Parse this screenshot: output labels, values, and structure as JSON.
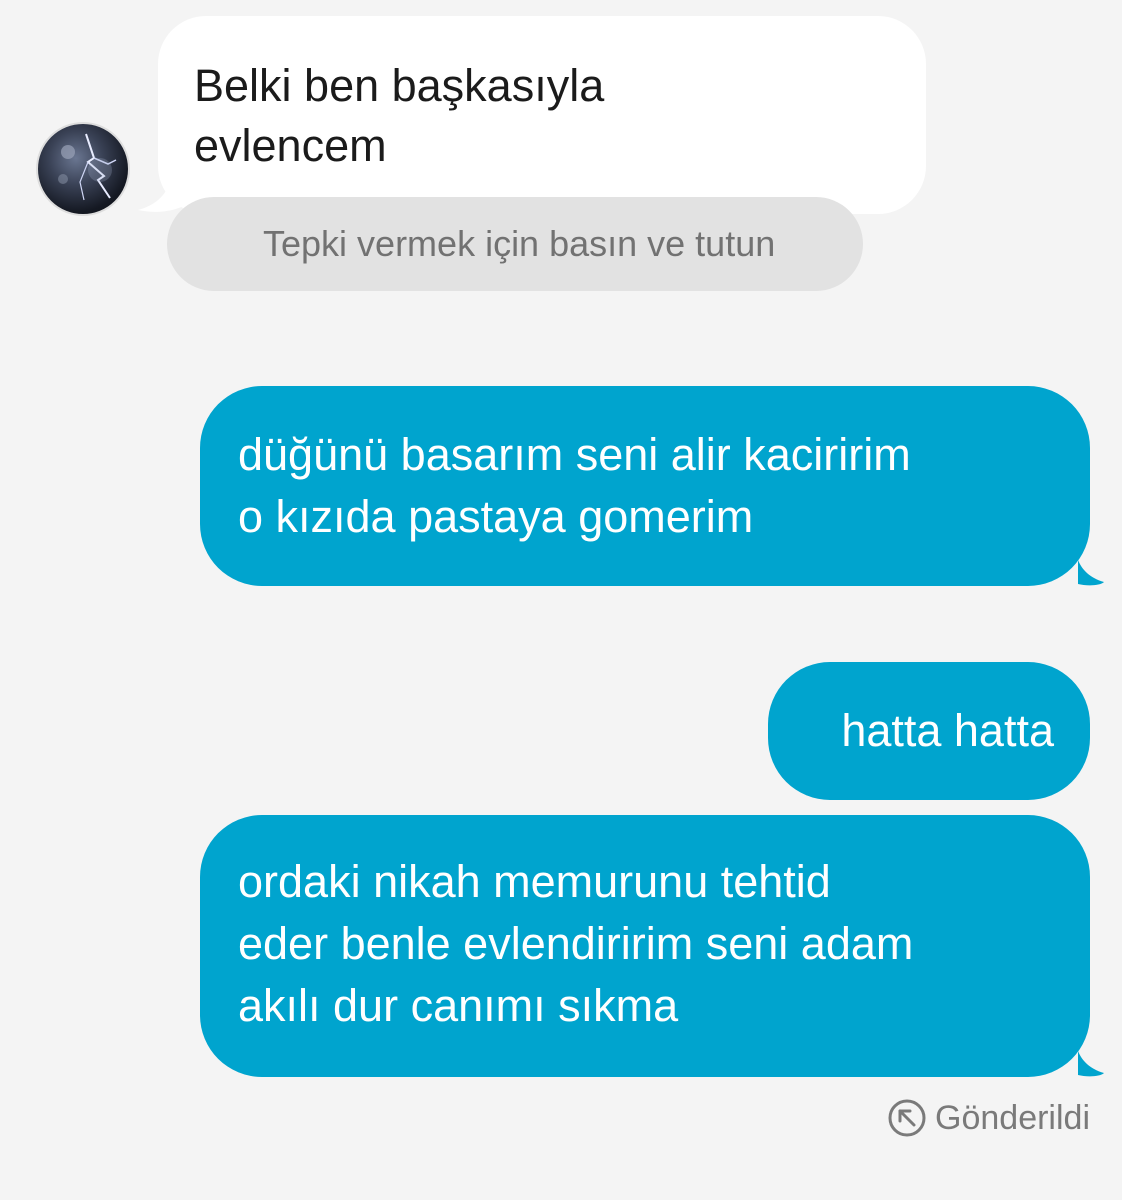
{
  "incoming": {
    "avatar_icon": "lightning-storm-avatar",
    "lines": [
      "Belki ben başkasıyla",
      "evlencem"
    ],
    "reaction_hint": "Tepki vermek için basın ve tutun"
  },
  "outgoing": [
    {
      "lines": [
        "düğünü basarım seni alir kaciririm",
        "o kızıda pastaya gomerim"
      ]
    },
    {
      "lines": [
        "hatta hatta"
      ]
    },
    {
      "lines": [
        "ordaki nikah memurunu tehtid",
        "eder benle evlendiririm seni adam",
        "akılı dur canımı sıkma"
      ]
    }
  ],
  "status": {
    "icon": "sent-arrow-icon",
    "label": "Gönderildi"
  },
  "colors": {
    "background": "#f4f4f4",
    "incoming_bubble": "#ffffff",
    "outgoing_bubble": "#00a4ce",
    "reaction_hint_bg": "#e2e2e2",
    "muted_text": "#7a7a7a"
  }
}
